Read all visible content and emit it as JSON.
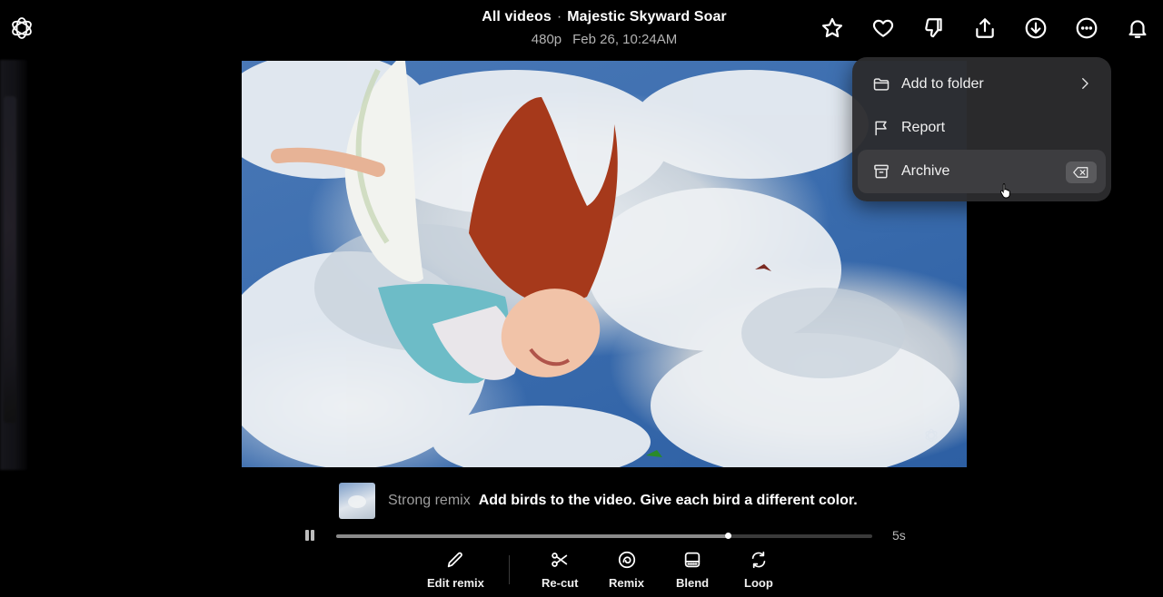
{
  "header": {
    "breadcrumb": "All videos",
    "separator": "·",
    "title": "Majestic Skyward Soar",
    "resolution": "480p",
    "date": "Feb 26, 10:24AM"
  },
  "top_actions": [
    {
      "icon": "star-icon"
    },
    {
      "icon": "heart-icon"
    },
    {
      "icon": "thumbs-down-icon"
    },
    {
      "icon": "share-icon"
    },
    {
      "icon": "download-icon"
    },
    {
      "icon": "more-options-icon"
    },
    {
      "icon": "bell-icon"
    }
  ],
  "menu": {
    "items": [
      {
        "label": "Add to folder",
        "icon": "folder-icon",
        "has_submenu": true
      },
      {
        "label": "Report",
        "icon": "flag-icon"
      },
      {
        "label": "Archive",
        "icon": "archive-icon",
        "shortcut_icon": "backspace-icon",
        "highlighted": true
      }
    ]
  },
  "prompt": {
    "mode": "Strong remix",
    "text": "Add birds to the video. Give each bird a different color."
  },
  "player": {
    "progress": 0.73,
    "duration": "5s",
    "state": "playing"
  },
  "toolbar": {
    "edit_remix": "Edit remix",
    "recut": "Re-cut",
    "remix": "Remix",
    "blend": "Blend",
    "loop": "Loop"
  }
}
